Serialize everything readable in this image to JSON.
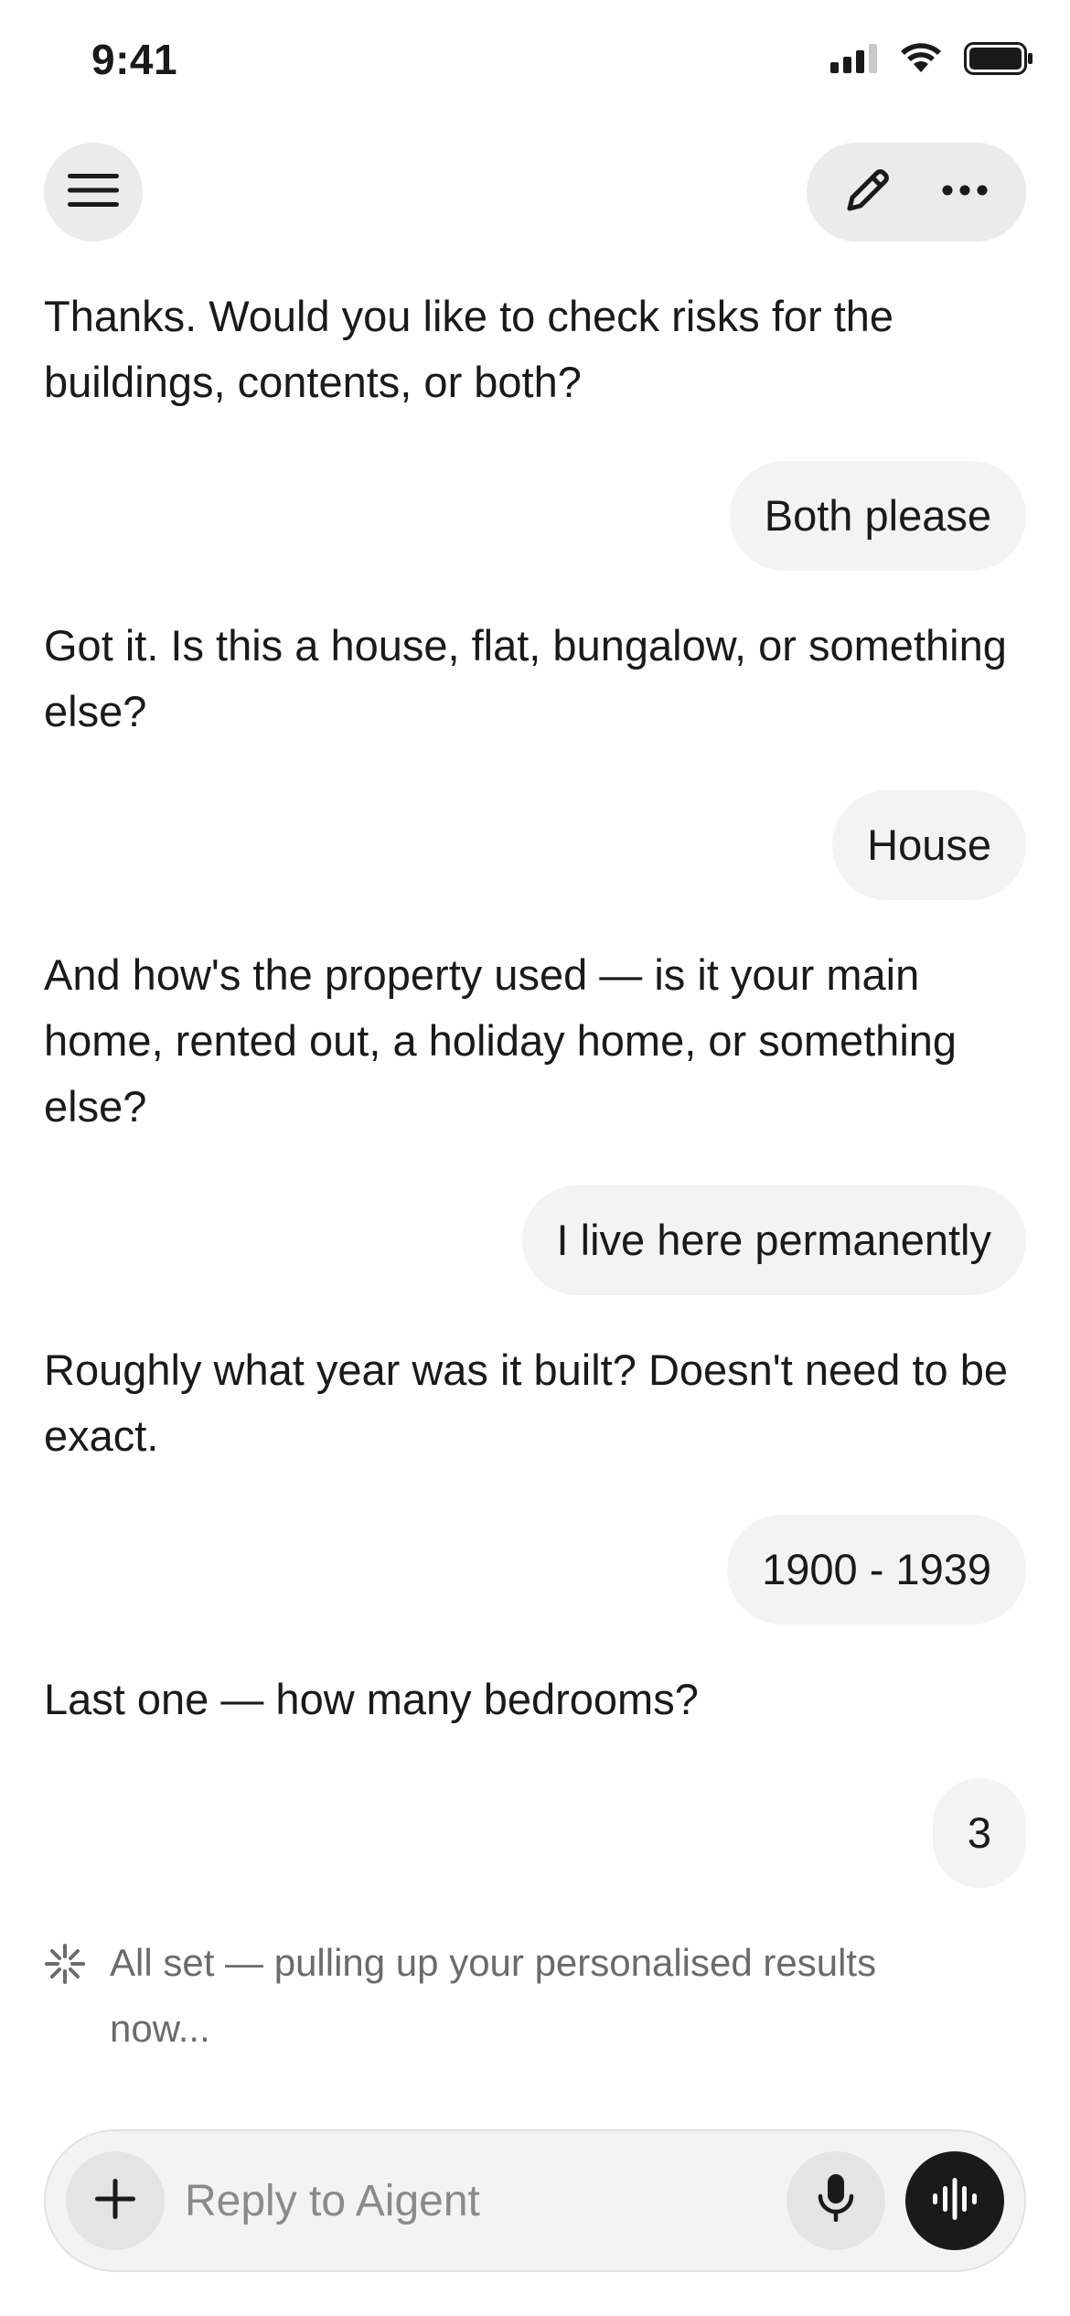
{
  "status_bar": {
    "time": "9:41",
    "icons": [
      "signal-icon",
      "wifi-icon",
      "battery-icon"
    ]
  },
  "header": {
    "menu_icon": "hamburger-menu-icon",
    "edit_icon": "pencil-icon",
    "more_icon": "more-horizontal-icon"
  },
  "conversation": [
    {
      "role": "assistant",
      "text": "Thanks. Would you like to check risks for the buildings, contents, or both?"
    },
    {
      "role": "user",
      "text": "Both please"
    },
    {
      "role": "assistant",
      "text": "Got it. Is this a house, flat, bungalow, or something else?"
    },
    {
      "role": "user",
      "text": "House"
    },
    {
      "role": "assistant",
      "text": "And how's the property used — is it your main home, rented out, a holiday home, or something else?"
    },
    {
      "role": "user",
      "text": "I live here permanently"
    },
    {
      "role": "assistant",
      "text": "Roughly what year was it built? Doesn't need to be exact."
    },
    {
      "role": "user",
      "text": "1900 - 1939"
    },
    {
      "role": "assistant",
      "text": "Last one — how many bedrooms?"
    },
    {
      "role": "user",
      "text": "3"
    }
  ],
  "status": {
    "icon": "sparkle-loading-icon",
    "text": "All set — pulling up your personalised results now..."
  },
  "composer": {
    "placeholder": "Reply to Aigent",
    "value": "",
    "add_icon": "plus-icon",
    "mic_icon": "microphone-icon",
    "voice_icon": "voice-waveform-icon"
  },
  "colors": {
    "background": "#ffffff",
    "bubble": "#f3f3f3",
    "button": "#ebebeb",
    "text": "#1a1a1a",
    "muted_text": "#6b6b6b",
    "voice_button": "#1a1a1a"
  }
}
